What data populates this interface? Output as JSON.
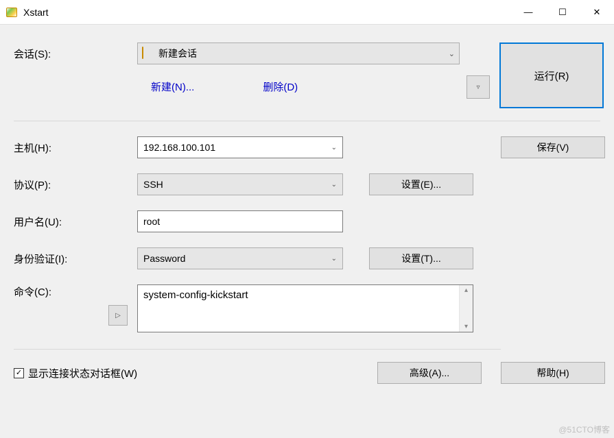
{
  "window": {
    "title": "Xstart",
    "minimize": "—",
    "maximize": "☐",
    "close": "✕"
  },
  "session": {
    "label": "会话(S):",
    "selected": "新建会话",
    "new_label": "新建(N)...",
    "delete_label": "删除(D)",
    "dropdown_glyph": "▿"
  },
  "run": {
    "label": "运行(R)"
  },
  "host": {
    "label": "主机(H):",
    "value": "192.168.100.101"
  },
  "protocol": {
    "label": "协议(P):",
    "value": "SSH",
    "settings_label": "设置(E)..."
  },
  "username": {
    "label": "用户名(U):",
    "value": "root"
  },
  "auth": {
    "label": "身份验证(I):",
    "value": "Password",
    "settings_label": "设置(T)..."
  },
  "command": {
    "label": "命令(C):",
    "value": "system-config-kickstart",
    "expand_glyph": "▷"
  },
  "save": {
    "label": "保存(V)"
  },
  "footer": {
    "show_status_label": "显示连接状态对话框(W)",
    "show_status_checked": true,
    "advanced_label": "高级(A)...",
    "help_label": "帮助(H)"
  },
  "watermark": "@51CTO博客",
  "glyphs": {
    "chev_down": "⌄",
    "check": "✓",
    "scroll_up": "▴",
    "scroll_down": "▾"
  }
}
